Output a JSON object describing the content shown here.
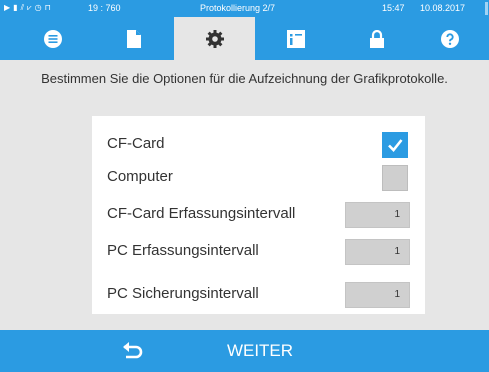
{
  "status_bar": {
    "counter": "19 : 760",
    "title": "Protokollierung 2/7",
    "time": "15:47",
    "date": "10.08.2017",
    "icons": [
      "play-icon",
      "document-icon",
      "signal-icon",
      "chart-icon",
      "clock-icon",
      "lock-icon"
    ]
  },
  "tabs": [
    {
      "icon": "list-icon",
      "active": false
    },
    {
      "icon": "document-icon",
      "active": false
    },
    {
      "icon": "gear-icon",
      "active": true
    },
    {
      "icon": "info-document-icon",
      "active": false
    },
    {
      "icon": "lock-icon",
      "active": false
    },
    {
      "icon": "help-icon",
      "active": false
    }
  ],
  "instruction": "Bestimmen Sie die Optionen für die Aufzeichnung der Grafikprotokolle.",
  "options": [
    {
      "label": "CF-Card",
      "type": "checkbox",
      "checked": true
    },
    {
      "label": "Computer",
      "type": "checkbox",
      "checked": false
    },
    {
      "label": "CF-Card Erfassungsintervall",
      "type": "number",
      "value": "1"
    },
    {
      "label": "PC Erfassungsintervall",
      "type": "number",
      "value": "1"
    },
    {
      "label": "PC Sicherungsintervall",
      "type": "number",
      "value": "1"
    }
  ],
  "footer": {
    "back_icon": "back-arrow-icon",
    "next_label": "WEITER"
  },
  "colors": {
    "accent": "#2b9be2",
    "background": "#e6e6e6",
    "panel": "#ffffff",
    "field": "#d0d0d0"
  }
}
